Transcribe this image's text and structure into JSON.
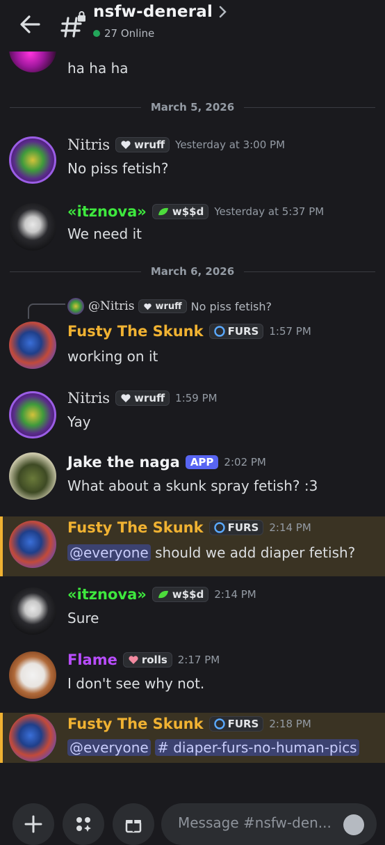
{
  "header": {
    "channel_name": "nsfw-deneral",
    "online": "27 Online"
  },
  "messages": {
    "top": {
      "text": "ha ha ha"
    },
    "sep1": "March 5, 2026",
    "m1": {
      "user": "Nitris",
      "tag": "wruff",
      "time": "Yesterday at 3:00 PM",
      "text": "No piss fetish?"
    },
    "m2": {
      "user": "«itznova»",
      "tag": "w$$d",
      "time": "Yesterday at 5:37 PM",
      "text": "We need it"
    },
    "sep2": "March 6, 2026",
    "reply": {
      "user": "@Nitris",
      "tag": "wruff",
      "text": "No piss fetish?"
    },
    "m3": {
      "user": "Fusty The Skunk",
      "tag": "FURS",
      "time": "1:57 PM",
      "text": "working on it"
    },
    "m4": {
      "user": "Nitris",
      "tag": "wruff",
      "time": "1:59 PM",
      "text": "Yay"
    },
    "m5": {
      "user": "Jake the naga",
      "badge": "APP",
      "time": "2:02 PM",
      "text": "What about a skunk spray fetish? :3"
    },
    "m6": {
      "user": "Fusty The Skunk",
      "tag": "FURS",
      "time": "2:14 PM",
      "mention": "@everyone",
      "text": " should we add diaper fetish?"
    },
    "m7": {
      "user": "«itznova»",
      "tag": "w$$d",
      "time": "2:14 PM",
      "text": "Sure"
    },
    "m8": {
      "user": "Flame",
      "tag": "rolls",
      "time": "2:17 PM",
      "text": "I don't see why not."
    },
    "m9": {
      "user": "Fusty The Skunk",
      "tag": "FURS",
      "time": "2:18 PM",
      "mention": "@everyone",
      "channel_link": "# diaper-furs-no-human-pics"
    }
  },
  "composer": {
    "placeholder": "Message #nsfw-den..."
  },
  "colors": {
    "background": "#1a1a1e",
    "highlight": "#3a3323",
    "highlight_bar": "#f0b232",
    "fusty_name": "#f0b232",
    "itznova_name": "#3ee83e",
    "flame_name": "#b94dff",
    "app_badge": "#5865f2",
    "online_dot": "#23a55a"
  },
  "icons": [
    "back-arrow-icon",
    "hashtag-lock-icon",
    "chevron-right-icon",
    "plus-icon",
    "apps-icon",
    "gift-icon",
    "emoji-icon"
  ]
}
